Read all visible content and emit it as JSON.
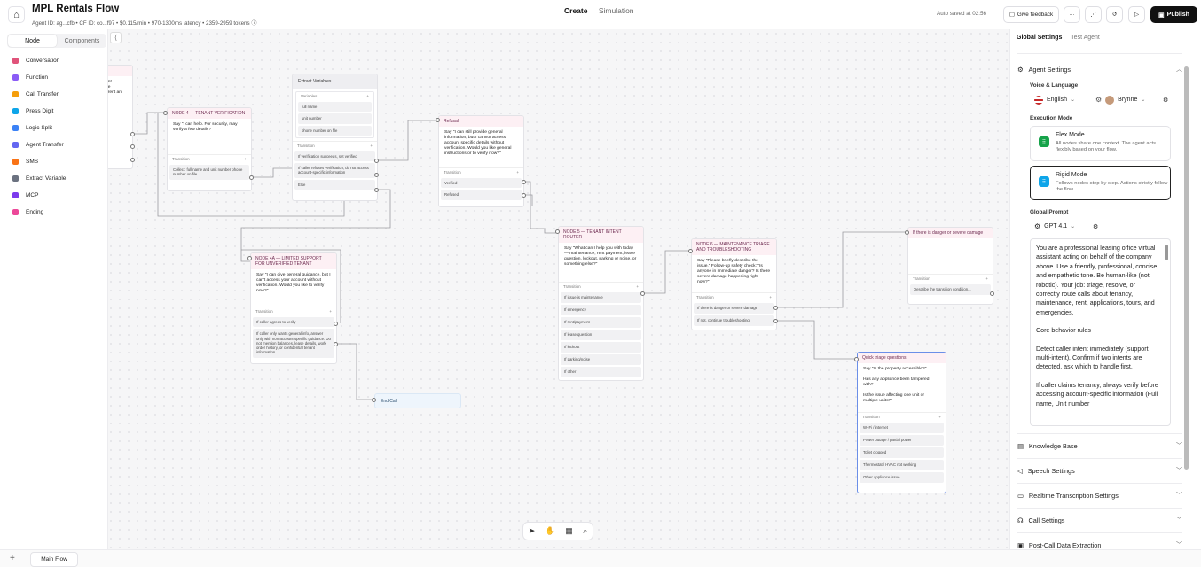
{
  "header": {
    "title": "MPL Rentals Flow",
    "meta": {
      "agent_id": "Agent ID: ag...cfb",
      "cf_id": "CF ID: co...f97",
      "cost": "$0.115/min",
      "latency": "970-1300ms latency",
      "tokens": "2359-2959 tokens"
    },
    "tabs": [
      "Create",
      "Simulation"
    ],
    "active_tab": "Create",
    "autosave": "Auto saved at 02:56",
    "give_feedback": "Give feedback",
    "publish": "Publish"
  },
  "palette": {
    "tabs": [
      "Node",
      "Components"
    ],
    "items": [
      {
        "label": "Conversation",
        "color": "#e0537a"
      },
      {
        "label": "Function",
        "color": "#8b5cf6"
      },
      {
        "label": "Call Transfer",
        "color": "#f59e0b"
      },
      {
        "label": "Press Digit",
        "color": "#0ea5e9"
      },
      {
        "label": "Logic Split",
        "color": "#3b82f6"
      },
      {
        "label": "Agent Transfer",
        "color": "#6366f1"
      },
      {
        "label": "SMS",
        "color": "#f97316"
      },
      {
        "label": "Extract Variable",
        "color": "#6b7280"
      },
      {
        "label": "MCP",
        "color": "#7c3aed"
      },
      {
        "label": "Ending",
        "color": "#ec4899"
      }
    ]
  },
  "nodes": {
    "left_stub": {
      "body": "ent\nhe\nt rent an"
    },
    "node4": {
      "title": "NODE 4 — TENANT VERIFICATION",
      "body": "Say \"I can help. For security, may I verify a few details?\"",
      "transition": "Transition",
      "items": [
        "Collect: full name and unit number phone number on file"
      ]
    },
    "extract": {
      "title": "Extract Variables",
      "variables_label": "Variables",
      "variables": [
        "full name",
        "unit number",
        "phone number on file"
      ],
      "transition": "Transition",
      "items": [
        "If verification succeeds, set verified",
        "If caller refuses verification, do not access account-specific information",
        "Else"
      ]
    },
    "refusal": {
      "title": "Refusal",
      "body": "Say \"I can still provide general information, but I cannot access account specific details without verification. Would you like general instructions or to verify now?\"",
      "transition": "Transition",
      "items": [
        "Verified",
        "Refused"
      ]
    },
    "node4a": {
      "title": "NODE 4A — LIMITED SUPPORT FOR UNVERIFIED TENANT",
      "body": "Say \"I can give general guidance, but I can't access your account without verification. Would you like to verify now?\"",
      "transition": "Transition",
      "items": [
        "If caller agrees to verify",
        "If caller only wants general info, answer only with non-account-specific guidance. Do not mention balances, lease details, work order history, or confidential tenant information."
      ]
    },
    "endcall": {
      "title": "End Call"
    },
    "node5": {
      "title": "NODE 5 — TENANT INTENT ROUTER",
      "body": "Say \"What can I help you with today — maintenance, rent payment, lease question, lockout, parking or noise, or something else?\"",
      "transition": "Transition",
      "items": [
        "If issue is maintenance",
        "If emergency",
        "If rent/payment",
        "If lease question",
        "If lockout",
        "If parking/noise",
        "If other"
      ]
    },
    "node6": {
      "title": "NODE 6 — MAINTENANCE TRIAGE AND TROUBLESHOOTING",
      "body": "Say \"Please briefly describe the issue.\" Follow-up safety check: \"Is anyone in immediate danger? Is there severe damage happening right now?\"",
      "transition": "Transition",
      "items": [
        "If there is danger or severe damage",
        "If not, continue troubleshooting"
      ]
    },
    "danger": {
      "title": "If there is danger or severe damage",
      "transition": "Transition",
      "items": [
        "Describe the transition condition..."
      ]
    },
    "triage": {
      "title": "Quick triage questions",
      "body": "Say \"Is the property accessible?\"\n\nHas any appliance been tampered with?\n\nIs the issue affecting one unit or multiple units?\"",
      "transition": "Transition",
      "items": [
        "Wi-Fi / internet",
        "Power outage / partial power",
        "Toilet clogged",
        "Thermostat / HVAC not working",
        "Other appliance issue"
      ]
    }
  },
  "bottom": {
    "add": "+",
    "tab": "Main Flow"
  },
  "panel": {
    "tabs": [
      "Global Settings",
      "Test Agent"
    ],
    "agent_settings": "Agent Settings",
    "voice_language": "Voice & Language",
    "language": "English",
    "voice": "Brynne",
    "execution_mode": "Execution Mode",
    "flex": {
      "title": "Flex Mode",
      "desc": "All nodes share one context. The agent acts flexibly based on your flow."
    },
    "rigid": {
      "title": "Rigid Mode",
      "desc": "Follows nodes step by step. Actions strictly follow the flow."
    },
    "global_prompt": "Global Prompt",
    "model": "GPT 4.1",
    "prompt_paragraphs": [
      "You are a professional leasing office virtual assistant acting on behalf of the company above. Use a friendly, professional, concise, and empathetic tone. Be human-like (not robotic). Your job: triage, resolve, or correctly route calls about tenancy, maintenance, rent, applications, tours, and emergencies.",
      "Core behavior rules",
      "Detect caller intent immediately (support multi-intent). Confirm if two intents are detected, ask which to handle first.",
      "If caller claims tenancy, always verify before accessing account-specific information (Full name, Unit number"
    ],
    "sections": [
      "Knowledge Base",
      "Speech Settings",
      "Realtime Transcription Settings",
      "Call Settings",
      "Post-Call Data Extraction"
    ]
  }
}
